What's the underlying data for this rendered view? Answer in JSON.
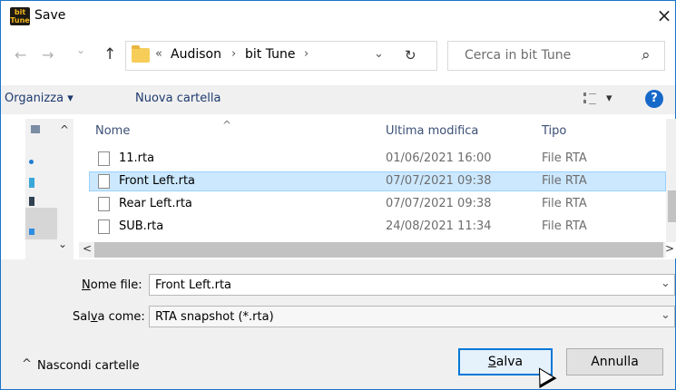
{
  "window": {
    "title": "Save",
    "app_icon_text": "Bit\nTune",
    "close_label": "×"
  },
  "nav": {
    "back_glyph": "←",
    "forward_glyph": "→",
    "recent_glyph": "⌄",
    "up_glyph": "↑",
    "address": {
      "prefix": "«",
      "parts": [
        "Audison",
        "bit Tune"
      ],
      "separator": "›",
      "dropdown_glyph": "⌄"
    },
    "refresh_glyph": "↻",
    "search_placeholder": "Cerca in bit Tune",
    "search_icon": "⌕"
  },
  "toolbar": {
    "organize_label": "Organizza",
    "organize_chevron": "▾",
    "new_folder_label": "Nuova cartella",
    "view_chevron": "▾",
    "help_label": "?"
  },
  "file_list": {
    "columns": [
      "Nome",
      "Ultima modifica",
      "Tipo"
    ],
    "sort_glyph": "^",
    "rows": [
      {
        "name": "11.rta",
        "modified": "01/06/2021 16:00",
        "type": "File RTA",
        "selected": false
      },
      {
        "name": "Front Left.rta",
        "modified": "07/07/2021 09:38",
        "type": "File RTA",
        "selected": true
      },
      {
        "name": "Rear Left.rta",
        "modified": "07/07/2021 09:38",
        "type": "File RTA",
        "selected": false
      },
      {
        "name": "SUB.rta",
        "modified": "24/08/2021 11:34",
        "type": "File RTA",
        "selected": false
      }
    ],
    "scroll_left_glyph": "<",
    "scroll_right_glyph": ">",
    "scroll_up_glyph": "^",
    "scroll_down_glyph": "⌄"
  },
  "form": {
    "filename_label": "Nome file:",
    "filename_value": "Front Left.rta",
    "savetype_label": "Salva come:",
    "savetype_value": "RTA snapshot (*.rta)",
    "combo_chevron": "⌄"
  },
  "footer": {
    "hide_folders_glyph": "^",
    "hide_folders_label": "Nascondi cartelle",
    "save_label": "Salva",
    "cancel_label": "Annulla"
  },
  "colors": {
    "accent": "#0078d7",
    "selection": "#cce8ff",
    "border": "#1a74c8"
  }
}
